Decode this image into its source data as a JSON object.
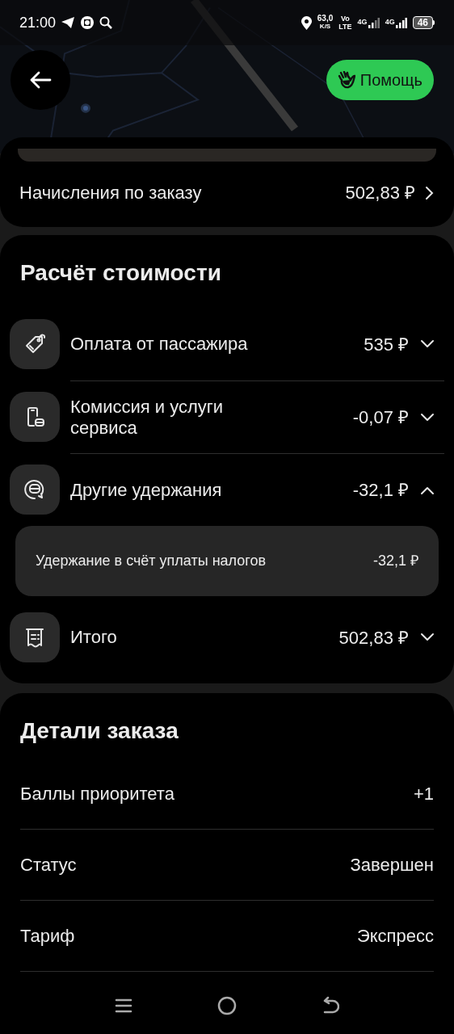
{
  "status_bar": {
    "time": "21:00",
    "net_speed": "63,0",
    "net_speed_unit": "K/S",
    "volte_top": "Vo",
    "volte_bottom": "LTE",
    "sim1": "4G",
    "sim2": "4G",
    "battery": "46"
  },
  "header": {
    "help_button": "Помощь"
  },
  "accruals": {
    "label": "Начисления по заказу",
    "amount": "502,83 ₽"
  },
  "cost": {
    "title": "Расчёт стоимости",
    "items": [
      {
        "kind": "tag",
        "label": "Оплата от пассажира",
        "amount": "535 ₽",
        "expanded": false
      },
      {
        "kind": "phone",
        "label": "Комиссия и услуги сервиса",
        "amount": "-0,07 ₽",
        "expanded": false
      },
      {
        "kind": "coins",
        "label": "Другие удержания",
        "amount": "-32,1 ₽",
        "expanded": true,
        "details": [
          {
            "label": "Удержание в счёт уплаты налогов",
            "amount": "-32,1 ₽"
          }
        ]
      },
      {
        "kind": "receipt",
        "label": "Итого",
        "amount": "502,83 ₽",
        "expanded": false
      }
    ]
  },
  "order_details": {
    "title": "Детали заказа",
    "rows": [
      {
        "label": "Баллы приоритета",
        "value": "+1"
      },
      {
        "label": "Статус",
        "value": "Завершен"
      },
      {
        "label": "Тариф",
        "value": "Экспресс"
      }
    ]
  }
}
